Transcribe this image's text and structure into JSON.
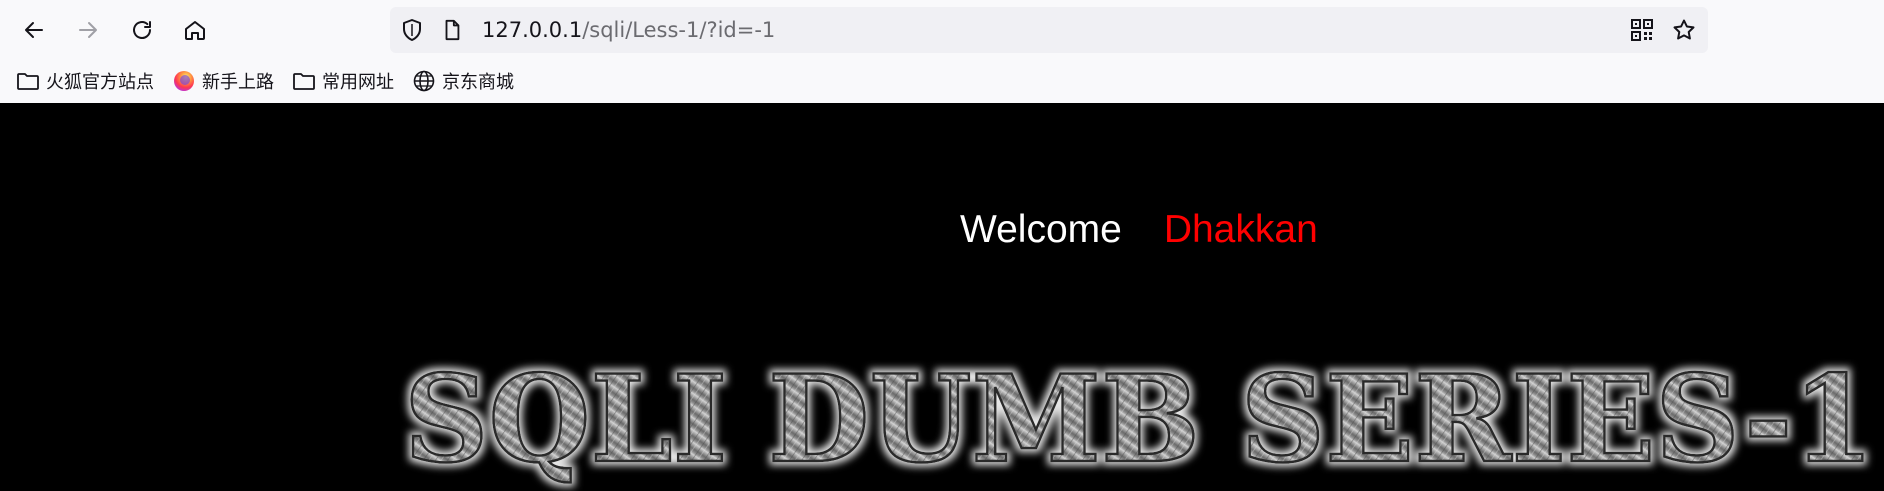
{
  "browser": {
    "nav": {
      "back_icon": "arrow-left-icon",
      "forward_icon": "arrow-right-icon",
      "reload_icon": "reload-icon",
      "home_icon": "home-icon"
    },
    "url": {
      "host": "127.0.0.1",
      "path": "/sqli/Less-1/?id=-1"
    },
    "bookmarks": [
      {
        "label": "火狐官方站点",
        "icon": "folder-icon"
      },
      {
        "label": "新手上路",
        "icon": "firefox-icon"
      },
      {
        "label": "常用网址",
        "icon": "folder-icon"
      },
      {
        "label": "京东商城",
        "icon": "globe-icon"
      }
    ]
  },
  "page": {
    "welcome": "Welcome",
    "name": "Dhakkan",
    "banner": "SQLI DUMB SERIES-1",
    "colors": {
      "background": "#000000",
      "welcome": "#ffffff",
      "name": "#ff0000"
    }
  }
}
